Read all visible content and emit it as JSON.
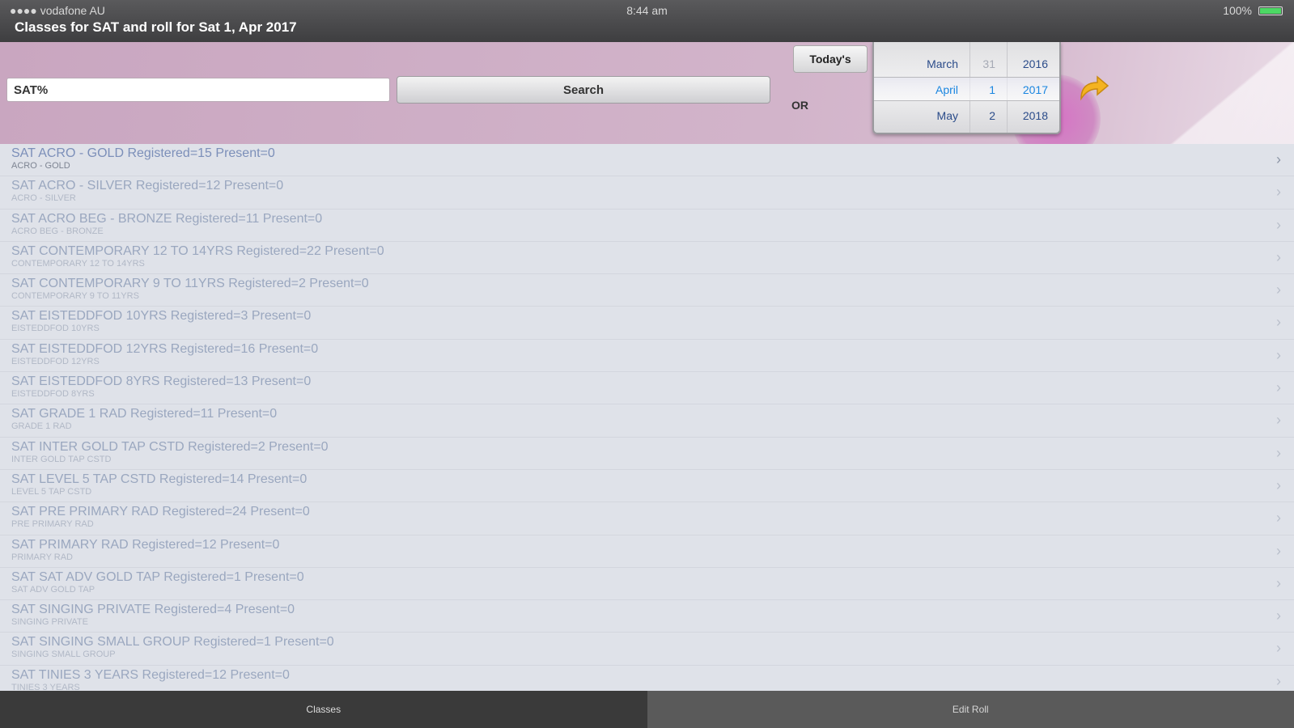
{
  "status_bar": {
    "carrier": "●●●● vodafone AU",
    "time": "8:44 am",
    "battery": "100%"
  },
  "title": "Classes for SAT and roll for Sat 1, Apr 2017",
  "search": {
    "value": "SAT%",
    "button_label": "Search"
  },
  "todays_label": "Today's",
  "or_label": "OR",
  "date_picker": {
    "rows": [
      {
        "month": "March",
        "day": "31",
        "year": "2016"
      },
      {
        "month": "April",
        "day": "1",
        "year": "2017"
      },
      {
        "month": "May",
        "day": "2",
        "year": "2018"
      }
    ]
  },
  "classes": [
    {
      "title": "SAT ACRO - GOLD Registered=15 Present=0",
      "subtitle": "ACRO - GOLD"
    },
    {
      "title": "SAT ACRO - SILVER Registered=12 Present=0",
      "subtitle": "ACRO - SILVER"
    },
    {
      "title": "SAT ACRO BEG - BRONZE Registered=11 Present=0",
      "subtitle": "ACRO BEG - BRONZE"
    },
    {
      "title": "SAT CONTEMPORARY 12 TO 14YRS Registered=22 Present=0",
      "subtitle": "CONTEMPORARY 12 TO 14YRS"
    },
    {
      "title": "SAT CONTEMPORARY 9 TO 11YRS Registered=2 Present=0",
      "subtitle": "CONTEMPORARY 9 TO 11YRS"
    },
    {
      "title": "SAT EISTEDDFOD 10YRS Registered=3 Present=0",
      "subtitle": "EISTEDDFOD 10YRS"
    },
    {
      "title": "SAT EISTEDDFOD 12YRS Registered=16 Present=0",
      "subtitle": "EISTEDDFOD 12YRS"
    },
    {
      "title": "SAT EISTEDDFOD 8YRS Registered=13 Present=0",
      "subtitle": "EISTEDDFOD 8YRS"
    },
    {
      "title": "SAT GRADE 1 RAD Registered=11 Present=0",
      "subtitle": "GRADE 1 RAD"
    },
    {
      "title": "SAT INTER GOLD TAP CSTD Registered=2 Present=0",
      "subtitle": "INTER GOLD TAP CSTD"
    },
    {
      "title": "SAT LEVEL 5 TAP CSTD Registered=14 Present=0",
      "subtitle": "LEVEL 5 TAP CSTD"
    },
    {
      "title": "SAT PRE PRIMARY RAD Registered=24 Present=0",
      "subtitle": "PRE PRIMARY RAD"
    },
    {
      "title": "SAT PRIMARY RAD Registered=12 Present=0",
      "subtitle": "PRIMARY RAD"
    },
    {
      "title": "SAT SAT ADV GOLD TAP Registered=1 Present=0",
      "subtitle": "SAT ADV GOLD TAP"
    },
    {
      "title": "SAT SINGING PRIVATE Registered=4 Present=0",
      "subtitle": "SINGING PRIVATE"
    },
    {
      "title": "SAT SINGING SMALL GROUP Registered=1 Present=0",
      "subtitle": "SINGING SMALL GROUP"
    },
    {
      "title": "SAT TINIES 3 YEARS Registered=12 Present=0",
      "subtitle": "TINIES 3 YEARS"
    }
  ],
  "tabs": [
    {
      "label": "Classes"
    },
    {
      "label": "Edit Roll"
    }
  ],
  "colors": {
    "title_bar": "#3e3e40",
    "header_bg": "#d2b4ca",
    "picker_selected": "#1a86e0",
    "arrow": "#f4b321"
  }
}
